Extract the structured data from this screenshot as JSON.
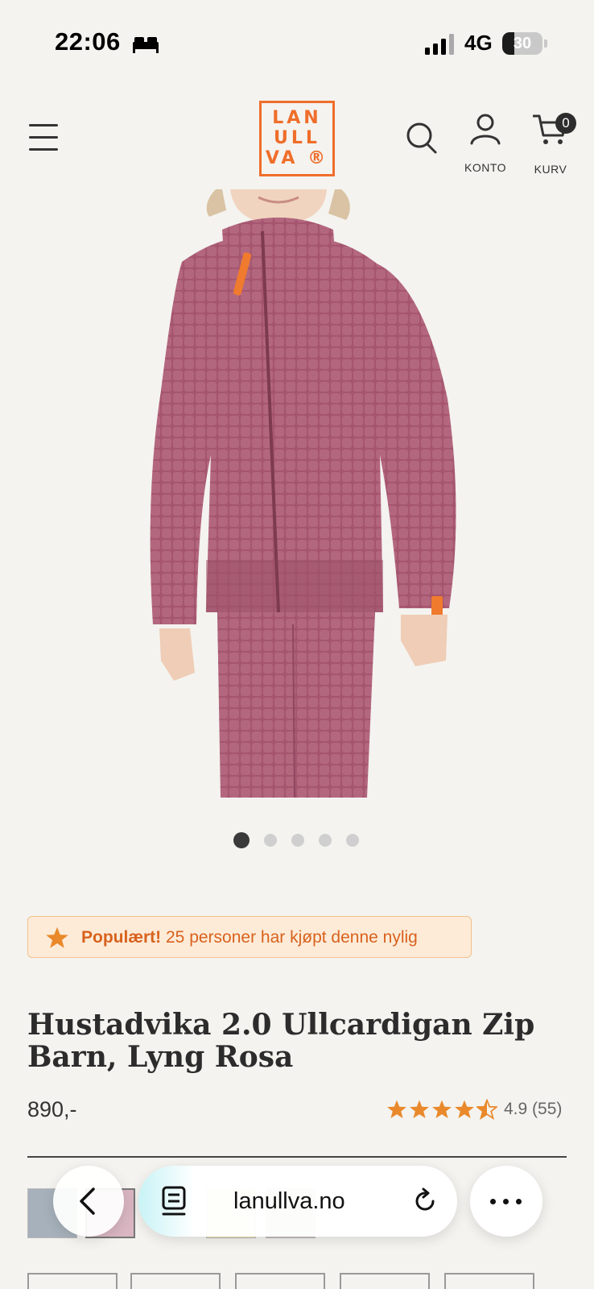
{
  "status_bar": {
    "time": "22:06",
    "network": "4G",
    "battery_percent": "30",
    "battery_level": 0.3,
    "icons": [
      "bed-icon",
      "signal-icon",
      "battery-icon"
    ]
  },
  "header": {
    "logo_lines": [
      "LAN",
      "ULL",
      "VA ®"
    ],
    "account_label": "KONTO",
    "cart_label": "KURV",
    "cart_count": "0",
    "icons": [
      "menu-icon",
      "search-icon",
      "account-icon",
      "cart-icon"
    ]
  },
  "gallery": {
    "image_alt": "Hustadvika 2.0 Ullcardigan Zip Barn, Lyng Rosa",
    "dot_count": 5,
    "active_index": 0
  },
  "popular": {
    "strong": "Populært!",
    "text": "25 personer har kjøpt denne nylig",
    "icon": "star-icon"
  },
  "product": {
    "title": "Hustadvika 2.0 Ullcardigan Zip Barn, Lyng Rosa",
    "price": "890,-",
    "rating_value": 4.5,
    "rating_text": "4.9 (55)"
  },
  "colors": {
    "accent": "#ef6e2b",
    "star": "#e9892b",
    "swatches": [
      "#a6b1bb",
      "#d9b6c2",
      "#ece1a6",
      "#c7b8b3"
    ]
  },
  "browser": {
    "url": "lanullva.no",
    "icons": [
      "back-icon",
      "tabs-icon",
      "reload-icon",
      "more-icon"
    ]
  }
}
